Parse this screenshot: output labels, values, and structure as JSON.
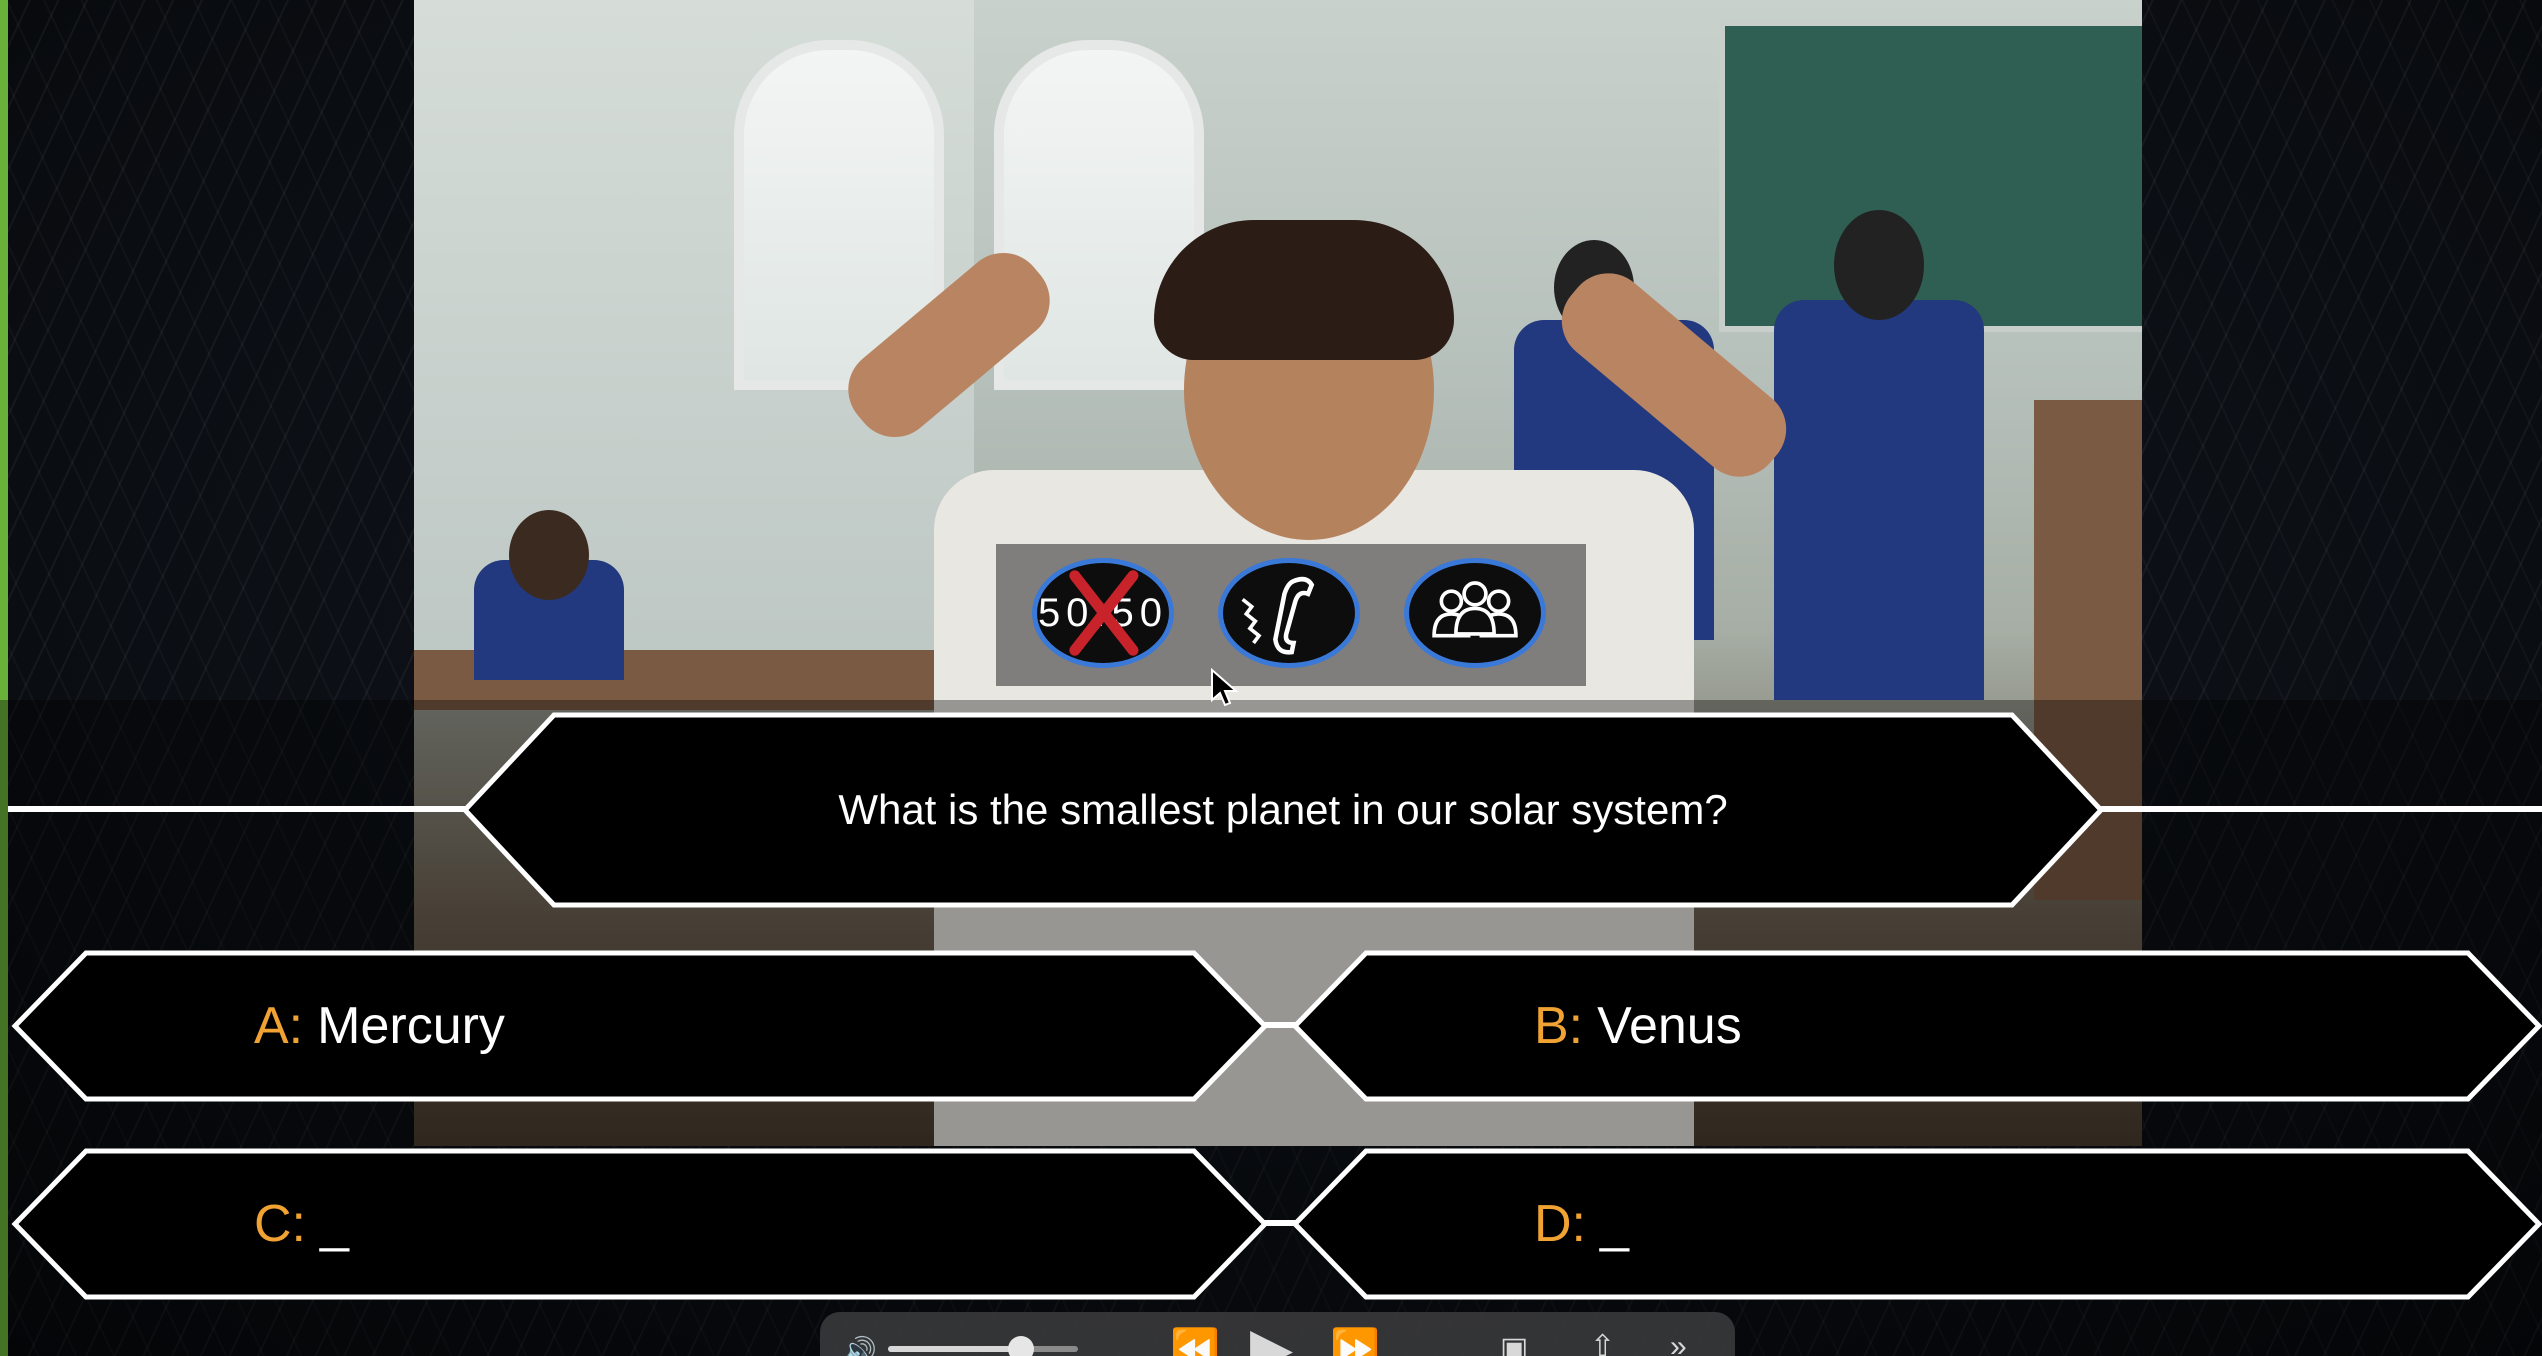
{
  "question": "What is the smallest planet in our solar system?",
  "answers": [
    {
      "letter": "A:",
      "text": "Mercury"
    },
    {
      "letter": "B:",
      "text": "Venus"
    },
    {
      "letter": "C:",
      "text": "_"
    },
    {
      "letter": "D:",
      "text": "_"
    }
  ],
  "lifelines": {
    "fifty_fifty": "50:50",
    "phone": "phone-a-friend-icon",
    "audience": "ask-the-audience-icon"
  },
  "colors": {
    "letter": "#f0a233",
    "lifeline_border": "#3a79d8",
    "outline": "#ffffff"
  },
  "controls": {
    "volume_fraction": 0.7
  }
}
